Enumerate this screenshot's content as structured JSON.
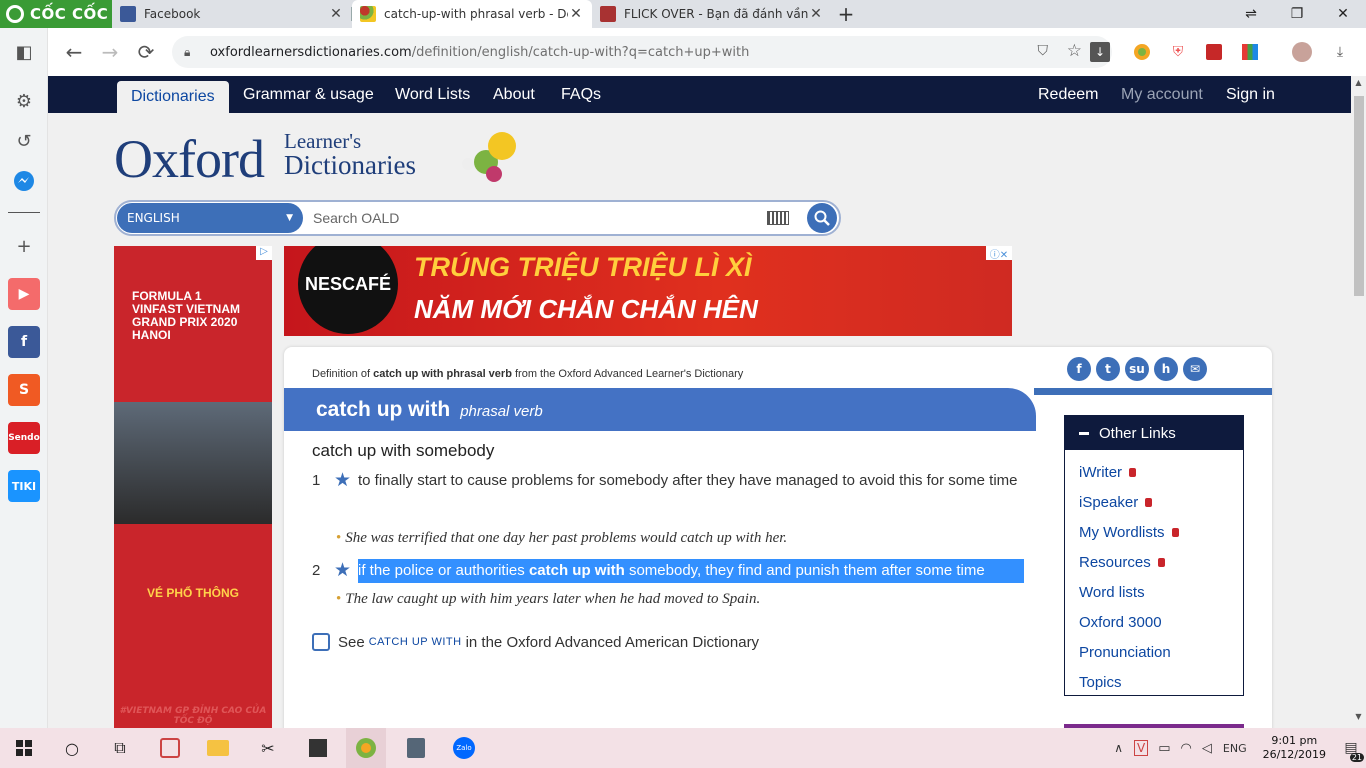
{
  "browser": {
    "brand": "CỐC CỐC",
    "tabs": [
      {
        "title": "Facebook",
        "close": "✕",
        "favicon_color": "#3b5998"
      },
      {
        "title": "catch-up-with phrasal verb - Defin",
        "close": "✕",
        "favicon_color": "#7cb342"
      },
      {
        "title": "FLICK OVER - Bạn đã đánh vần đúr",
        "close": "✕",
        "favicon_color": "#a83232"
      }
    ],
    "new_tab": "+",
    "url_domain": "oxfordlearnersdictionaries.com",
    "url_path": "/definition/english/catch-up-with?q=catch+up+with"
  },
  "site_nav": {
    "items": [
      "Dictionaries",
      "Grammar & usage",
      "Word Lists",
      "About",
      "FAQs"
    ],
    "right": [
      "Redeem",
      "My account",
      "Sign in"
    ]
  },
  "logo": {
    "main": "Oxford",
    "line1": "Learner's",
    "line2": "Dictionaries"
  },
  "search": {
    "dict": "ENGLISH",
    "placeholder": "Search OALD"
  },
  "ads": {
    "side_title": "FORMULA 1 VINFAST VIETNAM GRAND PRIX 2020 HANOI",
    "side_cta": "VÉ PHỔ THÔNG",
    "side_tag": "#VIETNAM GP ĐỈNH CAO CỦA TỐC ĐỘ",
    "top_brand": "NESCAFÉ",
    "top_line1": "TRÚNG TRIỆU TRIỆU LÌ XÌ",
    "top_line2": "NĂM MỚI CHẮN CHẮN HÊN"
  },
  "entry": {
    "def_of_prefix": "Definition of",
    "def_of_term": "catch up with phrasal verb",
    "def_of_suffix": "from the Oxford Advanced Learner's Dictionary",
    "headword": "catch up with",
    "pos": "phrasal verb",
    "phrase": "catch up with somebody",
    "senses": [
      {
        "num": "1",
        "def": "to finally start to cause problems for somebody after they have managed to avoid this for some time",
        "example": "She was terrified that one day her past problems would catch up with her."
      },
      {
        "num": "2",
        "def_pre": "if the police or authorities ",
        "def_bold": "catch up with",
        "def_post": " somebody, they find and punish them after some time",
        "example": "The law caught up with him years later when he had moved to Spain."
      }
    ],
    "see_pre": "See",
    "see_link": "CATCH UP WITH",
    "see_post": "in the Oxford Advanced American Dictionary"
  },
  "other_links": {
    "title": "Other Links",
    "items": [
      "iWriter",
      "iSpeaker",
      "My Wordlists",
      "Resources",
      "Word lists",
      "Oxford 3000",
      "Pronunciation",
      "Topics"
    ],
    "locked": [
      true,
      true,
      true,
      true,
      false,
      false,
      false,
      false
    ]
  },
  "taskbar": {
    "lang": "ENG",
    "time": "9:01 pm",
    "date": "26/12/2019",
    "notif": "21"
  }
}
